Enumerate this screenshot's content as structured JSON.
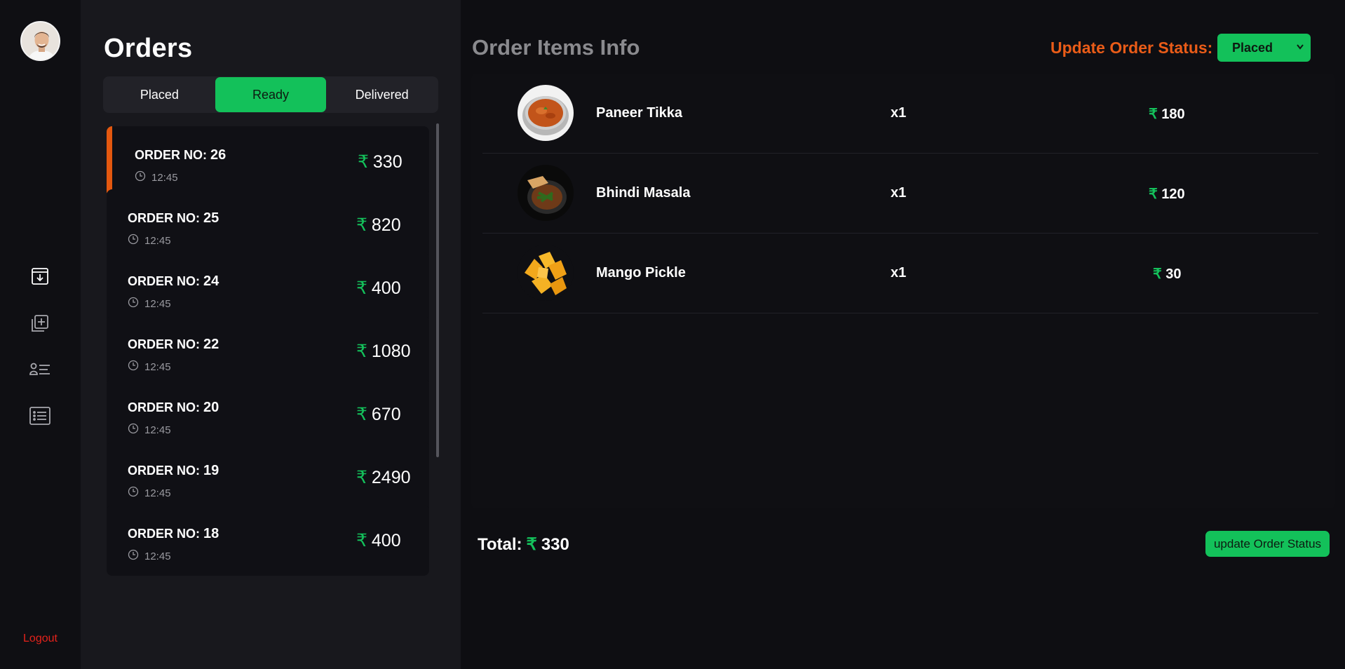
{
  "sidebar": {
    "nav": [
      {
        "icon": "download-box-icon"
      },
      {
        "icon": "add-item-icon"
      },
      {
        "icon": "user-list-icon"
      },
      {
        "icon": "menu-list-icon"
      }
    ],
    "logout_label": "Logout"
  },
  "orders": {
    "title": "Orders",
    "tabs": [
      {
        "label": "Placed",
        "active": false
      },
      {
        "label": "Ready",
        "active": true
      },
      {
        "label": "Delivered",
        "active": false
      }
    ],
    "prefix": "ORDER NO:",
    "currency": "₹",
    "list": [
      {
        "no": "26",
        "time": "12:45",
        "amount": "330",
        "selected": true
      },
      {
        "no": "25",
        "time": "12:45",
        "amount": "820",
        "selected": false
      },
      {
        "no": "24",
        "time": "12:45",
        "amount": "400",
        "selected": false
      },
      {
        "no": "22",
        "time": "12:45",
        "amount": "1080",
        "selected": false
      },
      {
        "no": "20",
        "time": "12:45",
        "amount": "670",
        "selected": false
      },
      {
        "no": "19",
        "time": "12:45",
        "amount": "2490",
        "selected": false
      },
      {
        "no": "18",
        "time": "12:45",
        "amount": "400",
        "selected": false
      }
    ]
  },
  "info": {
    "title": "Order Items Info",
    "status_label": "Update Order Status:",
    "status_value": "Placed",
    "items": [
      {
        "name": "Paneer Tikka",
        "qty": "x1",
        "price": "180"
      },
      {
        "name": "Bhindi Masala",
        "qty": "x1",
        "price": "120"
      },
      {
        "name": "Mango Pickle",
        "qty": "x1",
        "price": "30"
      }
    ],
    "total_label": "Total:",
    "total_value": "330",
    "update_button": "update Order Status"
  },
  "colors": {
    "accent_green": "#13c15a",
    "accent_orange": "#ea5c18",
    "logout_red": "#e5221b"
  }
}
